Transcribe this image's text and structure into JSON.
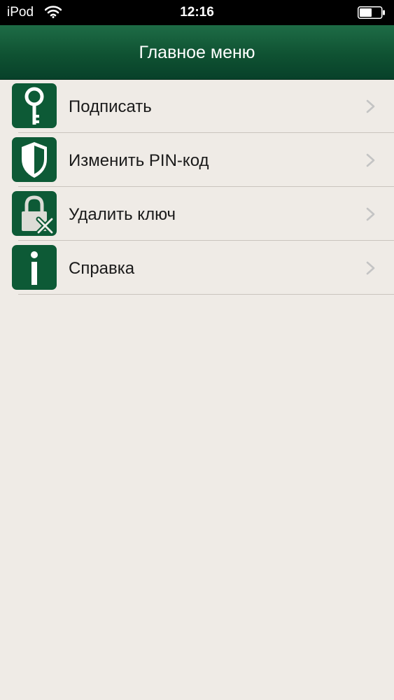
{
  "status_bar": {
    "carrier": "iPod",
    "time": "12:16",
    "icons": [
      "wifi-icon",
      "battery-icon"
    ]
  },
  "nav": {
    "title": "Главное меню"
  },
  "menu": {
    "items": [
      {
        "label": "Подписать",
        "icon": "key-icon"
      },
      {
        "label": "Изменить PIN-код",
        "icon": "shield-icon"
      },
      {
        "label": "Удалить ключ",
        "icon": "lock-delete-icon"
      },
      {
        "label": "Справка",
        "icon": "info-icon"
      }
    ]
  },
  "colors": {
    "header_green": "#0f5232",
    "icon_green": "#0d5a36",
    "background": "#efebe6",
    "separator": "#c9c4be"
  }
}
